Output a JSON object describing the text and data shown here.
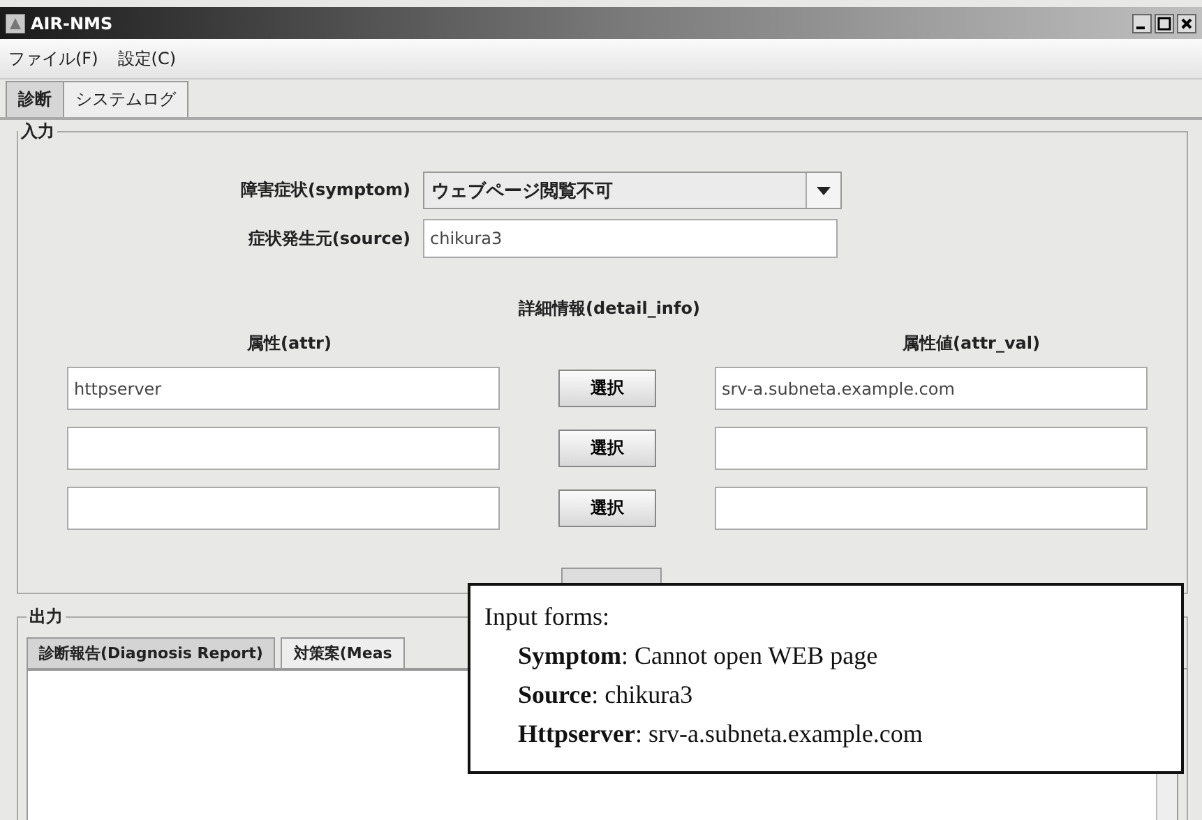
{
  "window": {
    "title": "AIR-NMS"
  },
  "menu": [
    "ファイル(F)",
    "設定(C)"
  ],
  "tabs": [
    {
      "label": "診断",
      "selected": true
    },
    {
      "label": "システムログ",
      "selected": false
    }
  ],
  "input": {
    "title": "入力",
    "symptom": {
      "label": "障害症状(symptom)",
      "value": "ウェブページ閲覧不可"
    },
    "source": {
      "label": "症状発生元(source)",
      "value": "chikura3"
    },
    "detail_title": "詳細情報(detail_info)",
    "attr_header": "属性(attr)",
    "attr_val_header": "属性値(attr_val)",
    "rows": [
      {
        "attr": "httpserver",
        "button": "選択",
        "value": "srv-a.subneta.example.com"
      },
      {
        "button": "選択"
      },
      {
        "button": "選択"
      }
    ]
  },
  "output": {
    "title": "出力",
    "tabs": [
      {
        "label": "診断報告(Diagnosis Report)",
        "selected": true
      },
      {
        "label": "対策案(Meas",
        "selected": false
      }
    ]
  },
  "annotation": {
    "title": "Input forms:",
    "lines": [
      "**Symptom**: Cannot open WEB page",
      "**Source**: chikura3",
      "**Httpserver**: srv-a.subneta.example.com"
    ]
  }
}
